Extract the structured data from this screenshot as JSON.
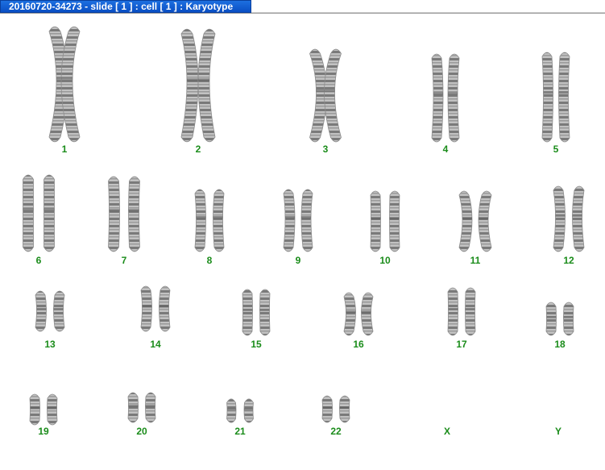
{
  "window": {
    "title": "20160720-34273 - slide [ 1 ] : cell [ 1 ] : Karyotype"
  },
  "colors": {
    "label": "#1a8c1a",
    "titlebar": "#0a4fc4",
    "chromosome": "#8c8c8c"
  },
  "karyotype": {
    "chromosomes": [
      {
        "label": "1",
        "count": 2
      },
      {
        "label": "2",
        "count": 2
      },
      {
        "label": "3",
        "count": 2
      },
      {
        "label": "4",
        "count": 2
      },
      {
        "label": "5",
        "count": 2
      },
      {
        "label": "6",
        "count": 2
      },
      {
        "label": "7",
        "count": 2
      },
      {
        "label": "8",
        "count": 2
      },
      {
        "label": "9",
        "count": 2
      },
      {
        "label": "10",
        "count": 2
      },
      {
        "label": "11",
        "count": 2
      },
      {
        "label": "12",
        "count": 2
      },
      {
        "label": "13",
        "count": 2
      },
      {
        "label": "14",
        "count": 2
      },
      {
        "label": "15",
        "count": 2
      },
      {
        "label": "16",
        "count": 2
      },
      {
        "label": "17",
        "count": 2
      },
      {
        "label": "18",
        "count": 2
      },
      {
        "label": "19",
        "count": 2
      },
      {
        "label": "20",
        "count": 2
      },
      {
        "label": "21",
        "count": 2
      },
      {
        "label": "22",
        "count": 2
      },
      {
        "label": "X",
        "count": 0
      },
      {
        "label": "Y",
        "count": 0
      }
    ]
  }
}
